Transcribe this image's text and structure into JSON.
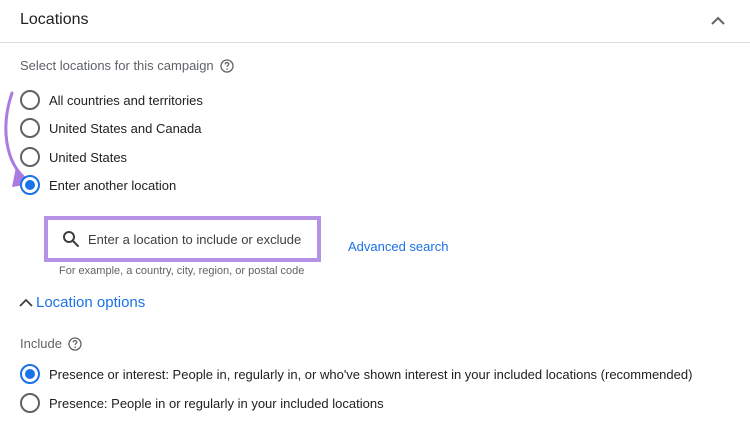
{
  "header": {
    "title": "Locations"
  },
  "locations": {
    "prompt": "Select locations for this campaign",
    "options": [
      {
        "label": "All countries and territories",
        "selected": false
      },
      {
        "label": "United States and Canada",
        "selected": false
      },
      {
        "label": "United States",
        "selected": false
      },
      {
        "label": "Enter another location",
        "selected": true
      }
    ]
  },
  "search": {
    "placeholder": "Enter a location to include or exclude",
    "value": "",
    "helper": "For example, a country, city, region, or postal code",
    "advanced_link": "Advanced search"
  },
  "location_options": {
    "toggle_label": "Location options",
    "include_label": "Include",
    "include_options": [
      {
        "label": "Presence or interest: People in, regularly in, or who've shown interest in your included locations (recommended)",
        "selected": true
      },
      {
        "label": "Presence: People in or regularly in your included locations",
        "selected": false
      }
    ]
  },
  "colors": {
    "accent": "#1a73e8",
    "highlight": "#b692e6",
    "annotation_arrow": "#a97be0"
  },
  "icons": {
    "collapse": "chevron-up-icon",
    "help": "question-circle-icon",
    "search": "magnifier-icon",
    "options_toggle": "chevron-up-icon",
    "annotation": "curved-arrow-icon"
  }
}
